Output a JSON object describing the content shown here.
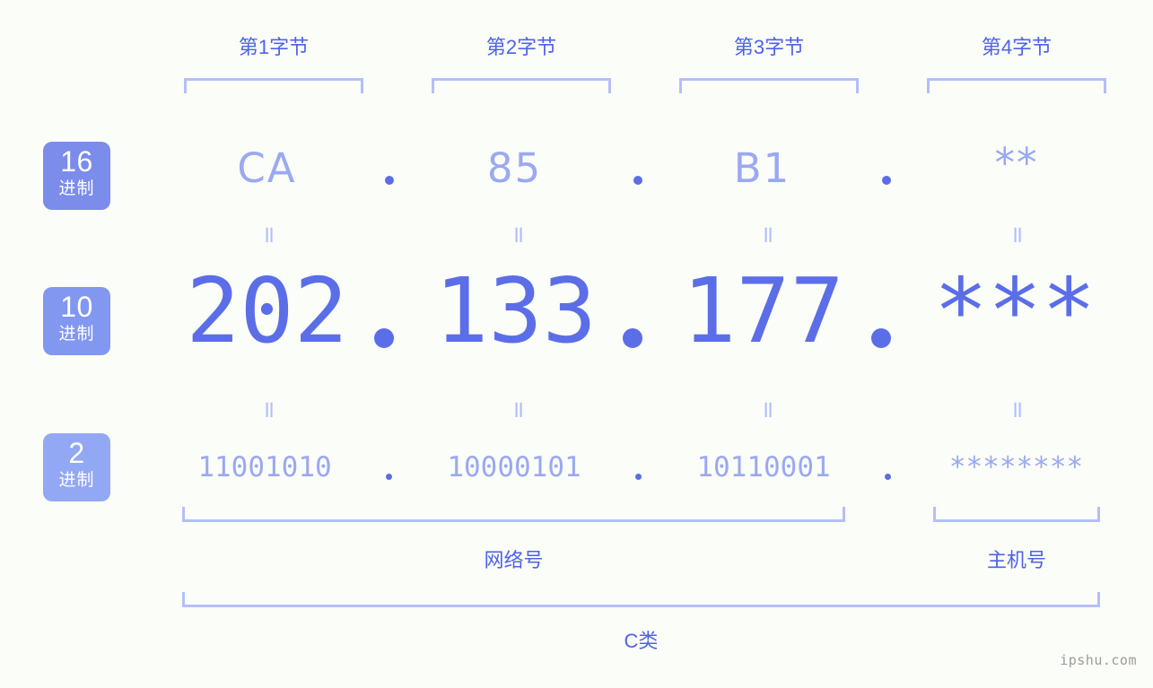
{
  "colors": {
    "background": "#fbfdf8",
    "accent_strong": "#5b6ee8",
    "accent_label": "#4f62e8",
    "accent_light": "#9aa9f2",
    "bracket": "#b3bffa",
    "badge_dark": "#7b8ceb",
    "badge_mid": "#8297f0",
    "badge_light": "#93a8f4",
    "watermark": "#9b9b9b"
  },
  "byte_headers": [
    {
      "label": "第1字节"
    },
    {
      "label": "第2字节"
    },
    {
      "label": "第3字节"
    },
    {
      "label": "第4字节"
    }
  ],
  "badges": [
    {
      "num": "16",
      "sys": "进制",
      "color": "#7b8ceb"
    },
    {
      "num": "10",
      "sys": "进制",
      "color": "#8297f0"
    },
    {
      "num": "2",
      "sys": "进制",
      "color": "#93a8f4"
    }
  ],
  "rows": {
    "hex": {
      "values": [
        "CA",
        "85",
        "B1",
        "**"
      ]
    },
    "decimal": {
      "values": [
        "202",
        "133",
        "177",
        "***"
      ]
    },
    "binary": {
      "values": [
        "11001010",
        "10000101",
        "10110001",
        "********"
      ]
    }
  },
  "separators": {
    "hex": ".",
    "decimal": ".",
    "binary": "."
  },
  "equals_mark": "=",
  "sections": [
    {
      "label": "网络号"
    },
    {
      "label": "主机号"
    }
  ],
  "ip_class": {
    "label": "C类"
  },
  "watermark": {
    "text": "ipshu.com"
  }
}
